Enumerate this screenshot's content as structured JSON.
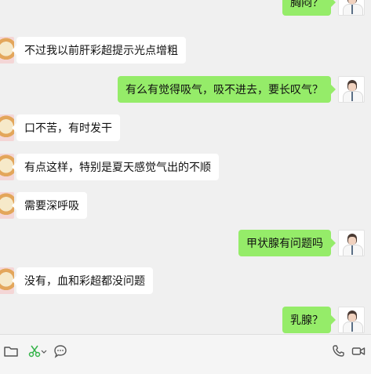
{
  "messages": [
    {
      "side": "right",
      "text": "胸闷？"
    },
    {
      "side": "left",
      "text": "不过我以前肝彩超提示光点增粗"
    },
    {
      "side": "right",
      "text": "有么有觉得吸气，吸不进去，要长叹气？"
    },
    {
      "side": "left",
      "text": "口不苦，有时发干"
    },
    {
      "side": "left",
      "text": "有点这样，特别是夏天感觉气出的不顺"
    },
    {
      "side": "left",
      "text": "需要深呼吸"
    },
    {
      "side": "right",
      "text": "甲状腺有问题吗"
    },
    {
      "side": "left",
      "text": "没有，血和彩超都没问题"
    },
    {
      "side": "right",
      "text": "乳腺？"
    }
  ],
  "toolbar": {
    "icons": [
      "folder-icon",
      "scissors-icon",
      "chat-icon",
      "phone-icon",
      "video-call-icon"
    ]
  }
}
